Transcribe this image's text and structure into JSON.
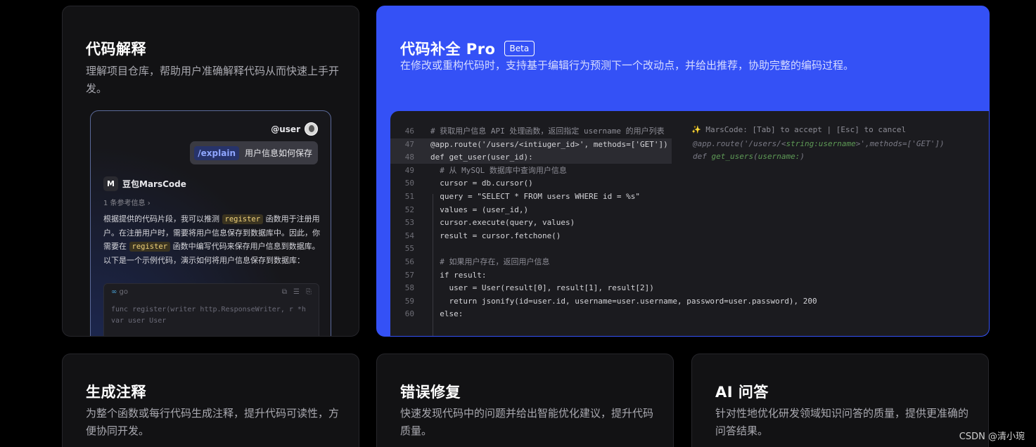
{
  "explain_card": {
    "title": "代码解释",
    "desc": "理解项目仓库，帮助用户准确解释代码从而快速上手开发。",
    "chat": {
      "user_name": "@user",
      "command": "/explain",
      "message": "用户信息如何保存",
      "bot_name": "豆包MarsCode",
      "bot_logo": "M",
      "references": "1 条参考信息 ›",
      "answer_1": "根据提供的代码片段，我可以推测",
      "keyword_1": "register",
      "answer_2": "函数用于注册用户。在注册用户时，需要将用户信息保存到数据库中。因此，你需要在",
      "keyword_2": "register",
      "answer_3": "函数中编写代码来保存用户信息到数据库。以下是一个示例代码，演示如何将用户信息保存到数据库：",
      "code_lang": "go",
      "code_line_1": "func register(writer http.ResponseWriter, r *h",
      "code_line_2": "  var user User"
    }
  },
  "pro_card": {
    "title": "代码补全 Pro",
    "badge": "Beta",
    "desc": "在修改或重构代码时，支持基于编辑行为预测下一个改动点，并给出推荐，协助完整的编码过程。",
    "hint": "✨ MarsCode: [Tab] to accept | [Esc] to cancel",
    "ghost_line_1_a": "@app.route('/users/<",
    "ghost_line_1_b": "string:username",
    "ghost_line_1_c": ">',methods=['GET'])",
    "ghost_line_2_a": "def ",
    "ghost_line_2_b": "get_users",
    "ghost_line_2_c": "(",
    "ghost_line_2_d": "username:",
    "ghost_line_2_e": ")",
    "lines": [
      {
        "n": "46",
        "text": "# 获取用户信息 API 处理函数，返回指定 username 的用户列表"
      },
      {
        "n": "47",
        "text": "@app.route('/users/<intiuger_id>', methods=['GET'])"
      },
      {
        "n": "48",
        "text": "def get_user(user_id):"
      },
      {
        "n": "49",
        "text": "  # 从 MySQL 数据库中查询用户信息"
      },
      {
        "n": "50",
        "text": "  cursor = db.cursor()"
      },
      {
        "n": "51",
        "text": "  query = \"SELECT * FROM users WHERE id = %s\""
      },
      {
        "n": "52",
        "text": "  values = (user_id,)"
      },
      {
        "n": "53",
        "text": "  cursor.execute(query, values)"
      },
      {
        "n": "54",
        "text": "  result = cursor.fetchone()"
      },
      {
        "n": "55",
        "text": ""
      },
      {
        "n": "56",
        "text": "  # 如果用户存在，返回用户信息"
      },
      {
        "n": "57",
        "text": "  if result:"
      },
      {
        "n": "58",
        "text": "    user = User(result[0], result[1], result[2])"
      },
      {
        "n": "59",
        "text": "    return jsonify(id=user.id, username=user.username, password=user.password), 200"
      },
      {
        "n": "60",
        "text": "  else:"
      }
    ]
  },
  "comment_card": {
    "title": "生成注释",
    "desc": "为整个函数或每行代码生成注释，提升代码可读性，方便协同开发。"
  },
  "fix_card": {
    "title": "错误修复",
    "desc": "快速发现代码中的问题并给出智能优化建议，提升代码质量。"
  },
  "qa_card": {
    "title": "AI 问答",
    "desc": "针对性地优化研发领域知识问答的质量，提供更准确的问答结果。"
  },
  "watermark": "CSDN @清小琬"
}
